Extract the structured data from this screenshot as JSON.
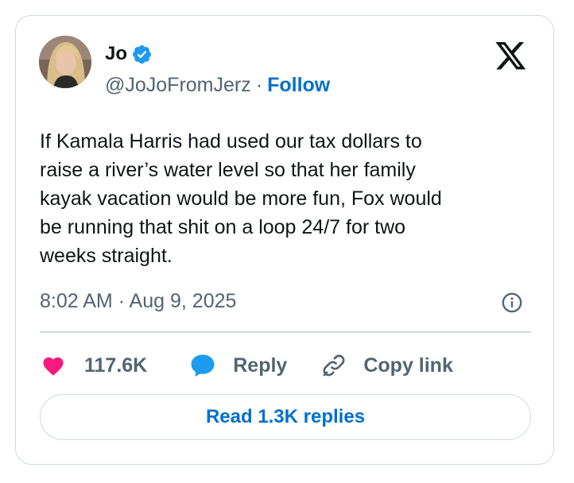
{
  "author": {
    "name": "Jo",
    "handle": "@JoJoFromJerz",
    "separator": "·",
    "follow_label": "Follow",
    "verified": true
  },
  "tweet": {
    "text": "If Kamala Harris had used our tax dollars to\nraise a river’s water level so that her family\nkayak vacation would be more fun, Fox would\nbe running that shit on a loop 24/7 for two\nweeks straight.",
    "timestamp": "8:02 AM · Aug 9, 2025"
  },
  "actions": {
    "like_count": "117.6K",
    "reply_label": "Reply",
    "copy_link_label": "Copy link"
  },
  "read_replies_label": "Read 1.3K replies",
  "colors": {
    "link_blue": "#0070cc",
    "verified_blue": "#1d9bf0",
    "like_pink": "#f91880",
    "reply_blue": "#1d9bf0",
    "text": "#0f1419",
    "muted": "#536471",
    "border": "#cfd9de"
  },
  "icons": {
    "brand": "x-logo-icon",
    "verified": "verified-badge-icon",
    "info": "info-icon",
    "like": "heart-icon",
    "reply": "speech-bubble-icon",
    "copy": "link-icon"
  }
}
